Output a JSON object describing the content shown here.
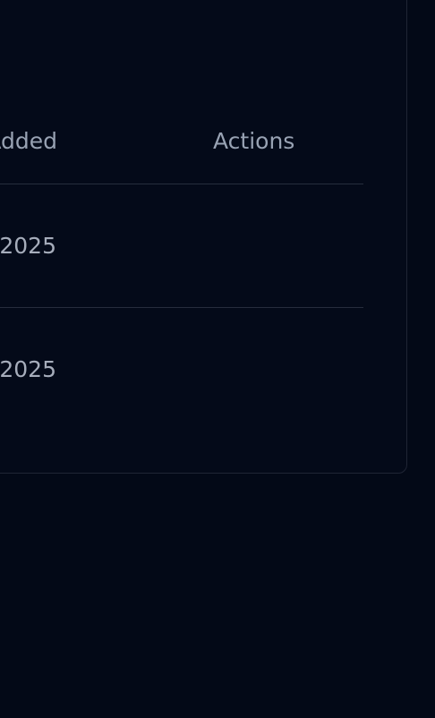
{
  "table": {
    "columns": {
      "date_added": "Date Added",
      "actions": "Actions"
    },
    "rows": [
      {
        "date_added": "2025"
      },
      {
        "date_added": "2025"
      }
    ]
  },
  "colors": {
    "background": "#030917",
    "card_border": "#1f2535",
    "row_divider": "#262d3d",
    "header_text": "#98a2b3",
    "cell_text": "#a6adbb"
  }
}
